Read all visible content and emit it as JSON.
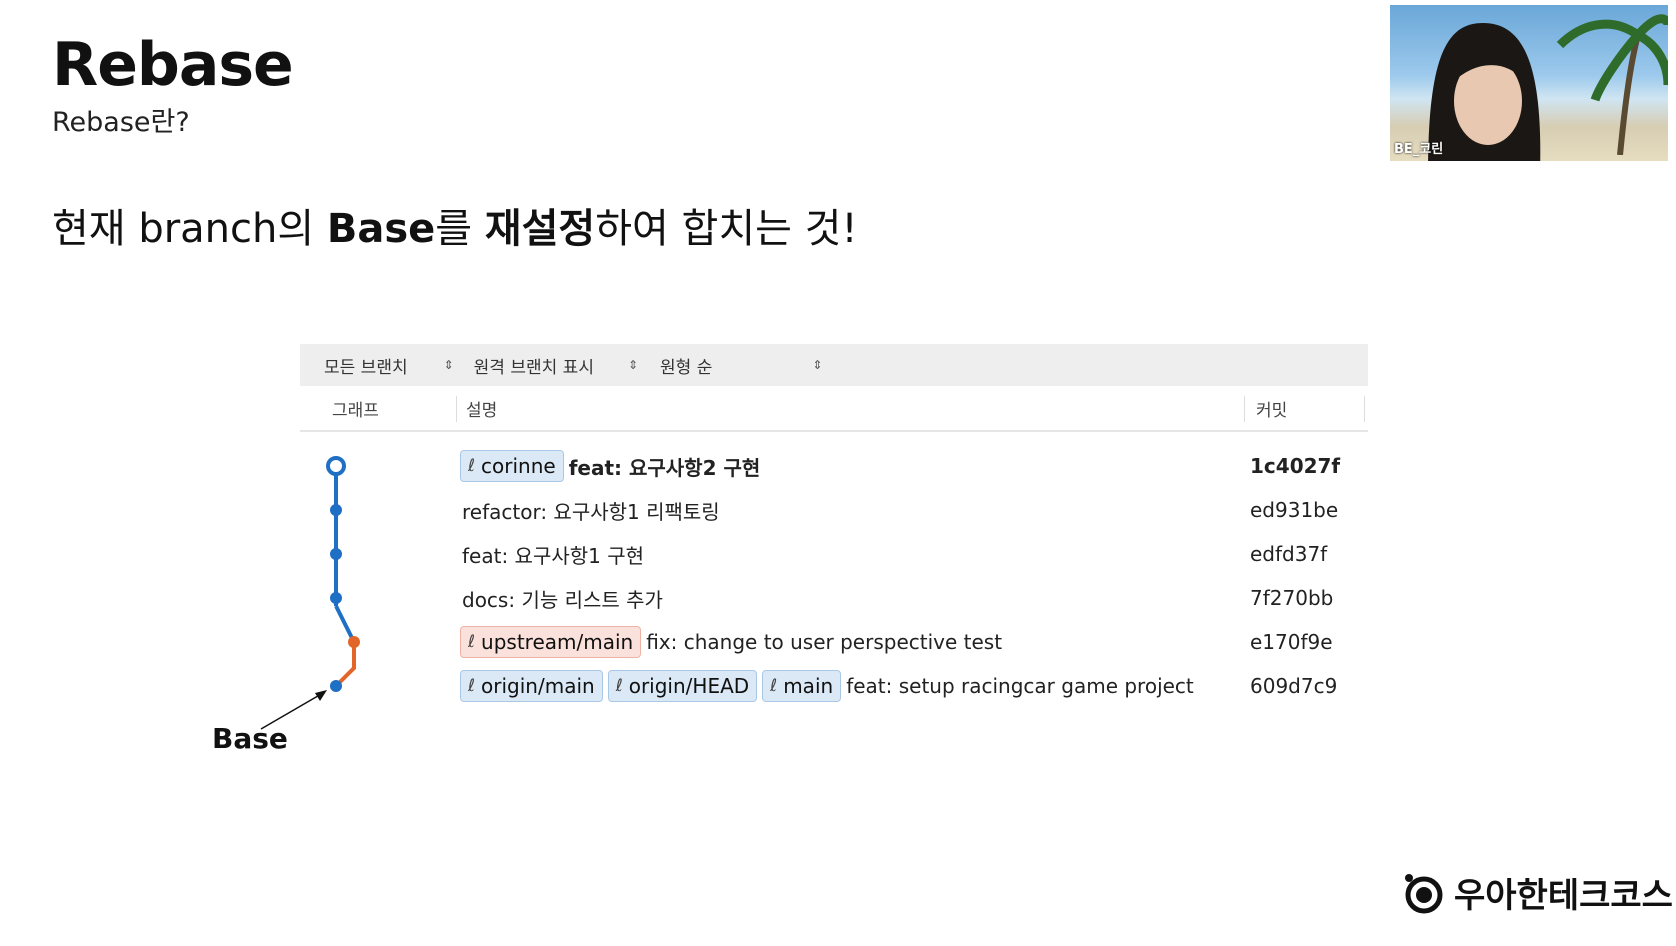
{
  "slide": {
    "title": "Rebase",
    "subtitle": "Rebase란?",
    "headline": {
      "part1": "현재 branch의 ",
      "bold1": "Base",
      "part2": "를 ",
      "bold2": "재설정",
      "part3": "하여 합치는 것!"
    },
    "base_label": "Base",
    "logo_text": "우아한테크코스"
  },
  "webcam": {
    "name": "BE_코린"
  },
  "git": {
    "toolbar": {
      "branches": "모든 브랜치",
      "remote": "원격 브랜치 표시",
      "order": "원형 순"
    },
    "columns": {
      "graph": "그래프",
      "description": "설명",
      "commit": "커밋"
    },
    "rows": [
      {
        "tags": [
          "corinne"
        ],
        "message": "feat: 요구사항2 구현",
        "hash": "1c4027f",
        "bold": true
      },
      {
        "tags": [],
        "message": "refactor: 요구사항1 리팩토링",
        "hash": "ed931be"
      },
      {
        "tags": [],
        "message": "feat: 요구사항1 구현",
        "hash": "edfd37f"
      },
      {
        "tags": [],
        "message": "docs: 기능 리스트 추가",
        "hash": "7f270bb"
      },
      {
        "tags": [
          "upstream/main"
        ],
        "message": "fix: change to user perspective test",
        "hash": "e170f9e"
      },
      {
        "tags": [
          "origin/main",
          "origin/HEAD",
          "main"
        ],
        "message": "feat: setup racingcar game project",
        "hash": "609d7c9"
      }
    ]
  },
  "colors": {
    "blue": "#1f6fc5",
    "orange": "#e2652a",
    "tag_blue": "#dbe9f6",
    "tag_red": "#fbe1dc"
  }
}
